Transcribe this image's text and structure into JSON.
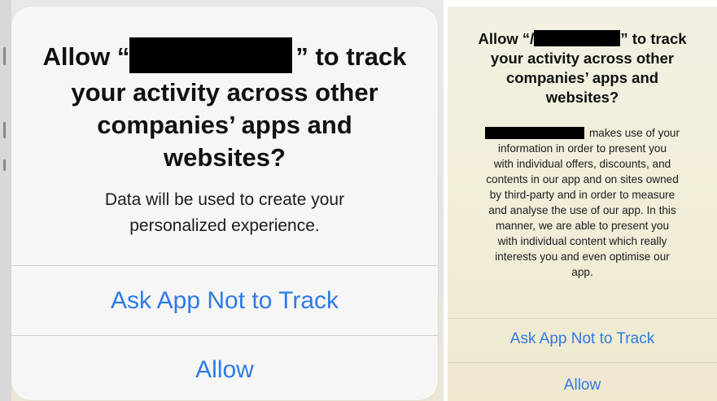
{
  "left_alert": {
    "title_lines": [
      {
        "pre": "Allow “",
        "post": "” to track"
      },
      "your activity across other",
      "companies’ apps and",
      "websites?"
    ],
    "message_lines": [
      "Data will be used to create your",
      "personalized experience."
    ],
    "buttons": {
      "ask_not_to_track": "Ask App Not to Track",
      "allow": "Allow"
    }
  },
  "right_alert": {
    "title_lines": [
      {
        "pre": "Allow “/",
        "post": "” to track"
      },
      "your activity across other",
      "companies’ apps and",
      "websites?"
    ],
    "message_lines": [
      {
        "post": "makes use of your"
      },
      "information in order to present you",
      "with individual offers, discounts, and",
      "contents in our app and on sites owned",
      "by third-party and in order to measure",
      "and analyse the use of our app. In this",
      "manner, we are able to present you",
      "with individual content which really",
      "interests you and even optimise our",
      "app."
    ],
    "buttons": {
      "ask_not_to_track": "Ask App Not to Track",
      "allow": "Allow"
    }
  },
  "colors": {
    "action_blue": "#2f7ae5",
    "redaction": "#000000"
  }
}
